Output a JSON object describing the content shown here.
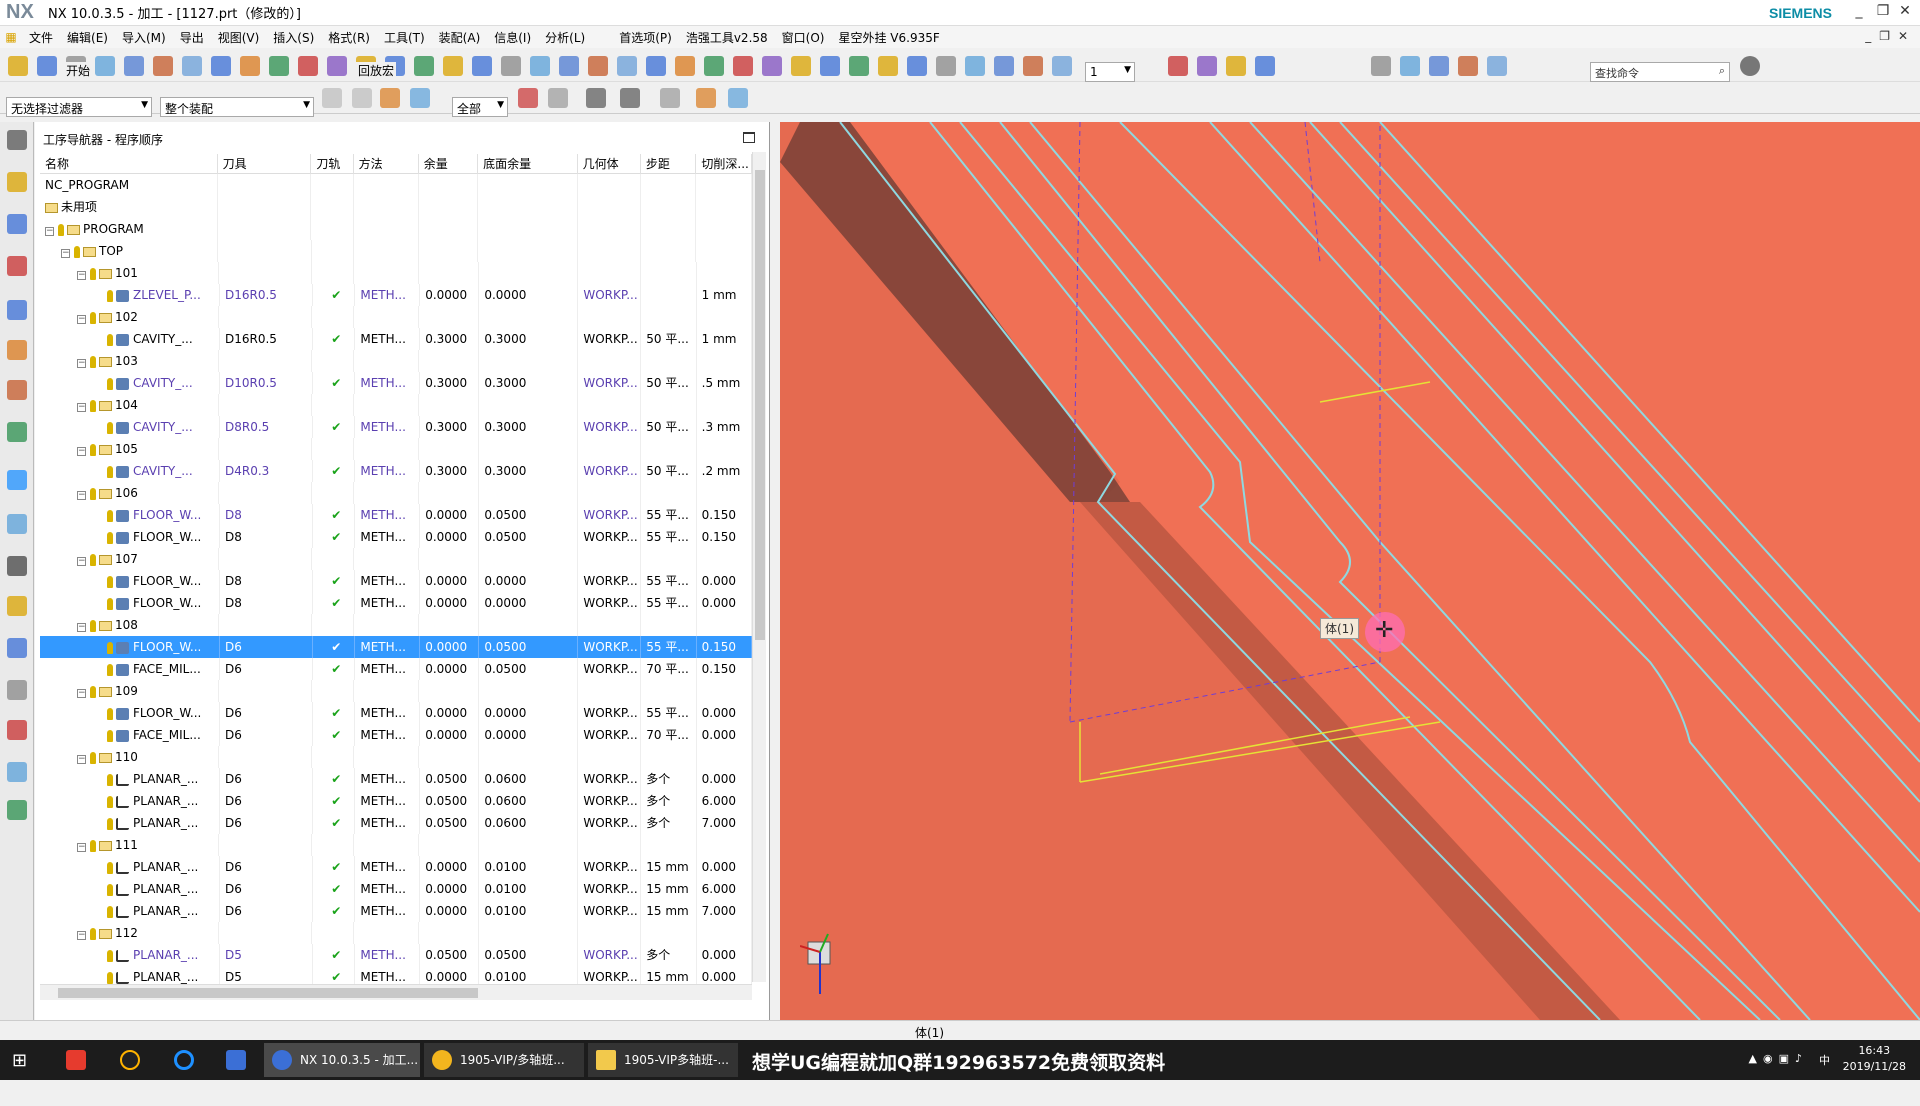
{
  "window": {
    "title": "NX 10.0.3.5 - 加工 - [1127.prt（修改的）]",
    "logo": "NX",
    "brand": "SIEMENS"
  },
  "menu": [
    "文件",
    "编辑(E)",
    "导入(M)",
    "导出",
    "视图(V)",
    "插入(S)",
    "格式(R)",
    "工具(T)",
    "装配(A)",
    "信息(I)",
    "分析(L)",
    "首选项(P)",
    "浩强工具v2.58",
    "窗口(O)",
    "星空外挂 V6.935F"
  ],
  "toolbar": {
    "start_label": "开始",
    "back_label": "回放宏",
    "layer_value": "1",
    "search_placeholder": "查找命令"
  },
  "filters": {
    "selection_filter": "无选择过滤器",
    "assembly": "整个装配",
    "scope": "全部"
  },
  "navigator": {
    "title": "工序导航器 - 程序顺序",
    "columns": [
      "名称",
      "刀具",
      "刀轨",
      "方法",
      "余量",
      "底面余量",
      "几何体",
      "步距",
      "切削深..."
    ],
    "rows": [
      {
        "level": 0,
        "type": "root",
        "name": "NC_PROGRAM",
        "tool": "",
        "path": "",
        "method": "",
        "stock": "",
        "floor": "",
        "geom": "",
        "step": "",
        "depth": ""
      },
      {
        "level": 1,
        "type": "folder",
        "name": "未用项",
        "tool": "",
        "path": "",
        "method": "",
        "stock": "",
        "floor": "",
        "geom": "",
        "step": "",
        "depth": ""
      },
      {
        "level": 1,
        "type": "group",
        "name": "PROGRAM",
        "tool": "",
        "path": "",
        "method": "",
        "stock": "",
        "floor": "",
        "geom": "",
        "step": "",
        "depth": ""
      },
      {
        "level": 2,
        "type": "group",
        "name": "TOP",
        "tool": "",
        "path": "",
        "method": "",
        "stock": "",
        "floor": "",
        "geom": "",
        "step": "",
        "depth": ""
      },
      {
        "level": 3,
        "type": "group",
        "name": "101",
        "tool": "",
        "path": "",
        "method": "",
        "stock": "",
        "floor": "",
        "geom": "",
        "step": "",
        "depth": ""
      },
      {
        "level": 4,
        "type": "op",
        "name": "ZLEVEL_P...",
        "tool": "D16R0.5",
        "path": "✔",
        "method": "METH...",
        "stock": "0.0000",
        "floor": "0.0000",
        "geom": "WORKP...",
        "step": "",
        "depth": "1 mm",
        "purple": true
      },
      {
        "level": 3,
        "type": "group",
        "name": "102",
        "tool": "",
        "path": "",
        "method": "",
        "stock": "",
        "floor": "",
        "geom": "",
        "step": "",
        "depth": ""
      },
      {
        "level": 4,
        "type": "op",
        "name": "CAVITY_...",
        "tool": "D16R0.5",
        "path": "✔",
        "method": "METH...",
        "stock": "0.3000",
        "floor": "0.3000",
        "geom": "WORKP...",
        "step": "50 平...",
        "depth": "1 mm"
      },
      {
        "level": 3,
        "type": "group",
        "name": "103",
        "tool": "",
        "path": "",
        "method": "",
        "stock": "",
        "floor": "",
        "geom": "",
        "step": "",
        "depth": ""
      },
      {
        "level": 4,
        "type": "op",
        "name": "CAVITY_...",
        "tool": "D10R0.5",
        "path": "✔",
        "method": "METH...",
        "stock": "0.3000",
        "floor": "0.3000",
        "geom": "WORKP...",
        "step": "50 平...",
        "depth": ".5 mm",
        "purple": true
      },
      {
        "level": 3,
        "type": "group",
        "name": "104",
        "tool": "",
        "path": "",
        "method": "",
        "stock": "",
        "floor": "",
        "geom": "",
        "step": "",
        "depth": ""
      },
      {
        "level": 4,
        "type": "op",
        "name": "CAVITY_...",
        "tool": "D8R0.5",
        "path": "✔",
        "method": "METH...",
        "stock": "0.3000",
        "floor": "0.3000",
        "geom": "WORKP...",
        "step": "50 平...",
        "depth": ".3 mm",
        "purple": true
      },
      {
        "level": 3,
        "type": "group",
        "name": "105",
        "tool": "",
        "path": "",
        "method": "",
        "stock": "",
        "floor": "",
        "geom": "",
        "step": "",
        "depth": ""
      },
      {
        "level": 4,
        "type": "op",
        "name": "CAVITY_...",
        "tool": "D4R0.3",
        "path": "✔",
        "method": "METH...",
        "stock": "0.3000",
        "floor": "0.3000",
        "geom": "WORKP...",
        "step": "50 平...",
        "depth": ".2 mm",
        "purple": true
      },
      {
        "level": 3,
        "type": "group",
        "name": "106",
        "tool": "",
        "path": "",
        "method": "",
        "stock": "",
        "floor": "",
        "geom": "",
        "step": "",
        "depth": ""
      },
      {
        "level": 4,
        "type": "op",
        "name": "FLOOR_W...",
        "tool": "D8",
        "path": "✔",
        "method": "METH...",
        "stock": "0.0000",
        "floor": "0.0500",
        "geom": "WORKP...",
        "step": "55 平...",
        "depth": "0.150",
        "purple": true
      },
      {
        "level": 4,
        "type": "op",
        "name": "FLOOR_W...",
        "tool": "D8",
        "path": "✔",
        "method": "METH...",
        "stock": "0.0000",
        "floor": "0.0500",
        "geom": "WORKP...",
        "step": "55 平...",
        "depth": "0.150"
      },
      {
        "level": 3,
        "type": "group",
        "name": "107",
        "tool": "",
        "path": "",
        "method": "",
        "stock": "",
        "floor": "",
        "geom": "",
        "step": "",
        "depth": ""
      },
      {
        "level": 4,
        "type": "op",
        "name": "FLOOR_W...",
        "tool": "D8",
        "path": "✔",
        "method": "METH...",
        "stock": "0.0000",
        "floor": "0.0000",
        "geom": "WORKP...",
        "step": "55 平...",
        "depth": "0.000"
      },
      {
        "level": 4,
        "type": "op",
        "name": "FLOOR_W...",
        "tool": "D8",
        "path": "✔",
        "method": "METH...",
        "stock": "0.0000",
        "floor": "0.0000",
        "geom": "WORKP...",
        "step": "55 平...",
        "depth": "0.000"
      },
      {
        "level": 3,
        "type": "group",
        "name": "108",
        "tool": "",
        "path": "",
        "method": "",
        "stock": "",
        "floor": "",
        "geom": "",
        "step": "",
        "depth": ""
      },
      {
        "level": 4,
        "type": "op",
        "name": "FLOOR_W...",
        "tool": "D6",
        "path": "✔",
        "method": "METH...",
        "stock": "0.0000",
        "floor": "0.0500",
        "geom": "WORKP...",
        "step": "55 平...",
        "depth": "0.150",
        "selected": true
      },
      {
        "level": 4,
        "type": "op",
        "name": "FACE_MIL...",
        "tool": "D6",
        "path": "✔",
        "method": "METH...",
        "stock": "0.0000",
        "floor": "0.0500",
        "geom": "WORKP...",
        "step": "70 平...",
        "depth": "0.150"
      },
      {
        "level": 3,
        "type": "group",
        "name": "109",
        "tool": "",
        "path": "",
        "method": "",
        "stock": "",
        "floor": "",
        "geom": "",
        "step": "",
        "depth": ""
      },
      {
        "level": 4,
        "type": "op",
        "name": "FLOOR_W...",
        "tool": "D6",
        "path": "✔",
        "method": "METH...",
        "stock": "0.0000",
        "floor": "0.0000",
        "geom": "WORKP...",
        "step": "55 平...",
        "depth": "0.000"
      },
      {
        "level": 4,
        "type": "op",
        "name": "FACE_MIL...",
        "tool": "D6",
        "path": "✔",
        "method": "METH...",
        "stock": "0.0000",
        "floor": "0.0000",
        "geom": "WORKP...",
        "step": "70 平...",
        "depth": "0.000"
      },
      {
        "level": 3,
        "type": "group",
        "name": "110",
        "tool": "",
        "path": "",
        "method": "",
        "stock": "",
        "floor": "",
        "geom": "",
        "step": "",
        "depth": ""
      },
      {
        "level": 4,
        "type": "op",
        "name": "PLANAR_...",
        "tool": "D6",
        "path": "✔",
        "method": "METH...",
        "stock": "0.0500",
        "floor": "0.0600",
        "geom": "WORKP...",
        "step": "多个",
        "depth": "0.000",
        "planar": true
      },
      {
        "level": 4,
        "type": "op",
        "name": "PLANAR_...",
        "tool": "D6",
        "path": "✔",
        "method": "METH...",
        "stock": "0.0500",
        "floor": "0.0600",
        "geom": "WORKP...",
        "step": "多个",
        "depth": "6.000",
        "planar": true
      },
      {
        "level": 4,
        "type": "op",
        "name": "PLANAR_...",
        "tool": "D6",
        "path": "✔",
        "method": "METH...",
        "stock": "0.0500",
        "floor": "0.0600",
        "geom": "WORKP...",
        "step": "多个",
        "depth": "7.000",
        "planar": true
      },
      {
        "level": 3,
        "type": "group",
        "name": "111",
        "tool": "",
        "path": "",
        "method": "",
        "stock": "",
        "floor": "",
        "geom": "",
        "step": "",
        "depth": ""
      },
      {
        "level": 4,
        "type": "op",
        "name": "PLANAR_...",
        "tool": "D6",
        "path": "✔",
        "method": "METH...",
        "stock": "0.0000",
        "floor": "0.0100",
        "geom": "WORKP...",
        "step": "15 mm",
        "depth": "0.000",
        "planar": true
      },
      {
        "level": 4,
        "type": "op",
        "name": "PLANAR_...",
        "tool": "D6",
        "path": "✔",
        "method": "METH...",
        "stock": "0.0000",
        "floor": "0.0100",
        "geom": "WORKP...",
        "step": "15 mm",
        "depth": "6.000",
        "planar": true
      },
      {
        "level": 4,
        "type": "op",
        "name": "PLANAR_...",
        "tool": "D6",
        "path": "✔",
        "method": "METH...",
        "stock": "0.0000",
        "floor": "0.0100",
        "geom": "WORKP...",
        "step": "15 mm",
        "depth": "7.000",
        "planar": true
      },
      {
        "level": 3,
        "type": "group",
        "name": "112",
        "tool": "",
        "path": "",
        "method": "",
        "stock": "",
        "floor": "",
        "geom": "",
        "step": "",
        "depth": ""
      },
      {
        "level": 4,
        "type": "op",
        "name": "PLANAR_...",
        "tool": "D5",
        "path": "✔",
        "method": "METH...",
        "stock": "0.0500",
        "floor": "0.0500",
        "geom": "WORKP...",
        "step": "多个",
        "depth": "0.000",
        "planar": true,
        "purple": true
      },
      {
        "level": 4,
        "type": "op",
        "name": "PLANAR_...",
        "tool": "D5",
        "path": "✔",
        "method": "METH...",
        "stock": "0.0000",
        "floor": "0.0100",
        "geom": "WORKP...",
        "step": "15 mm",
        "depth": "0.000",
        "planar": true
      }
    ]
  },
  "viewport": {
    "tag_label": "体(1)",
    "background": "#f07055",
    "toolpath_color": "#8fd8e0"
  },
  "statusbar": {
    "text": "体(1)"
  },
  "taskbar": {
    "tasks": [
      "NX 10.0.3.5 - 加工...",
      "1905-VIP/多轴班...",
      "1905-VIP多轴班-..."
    ],
    "marquee": "想学UG编程就加Q群192963572免费领取资料",
    "time": "16:43",
    "date": "2019/11/28",
    "ime": "中"
  }
}
